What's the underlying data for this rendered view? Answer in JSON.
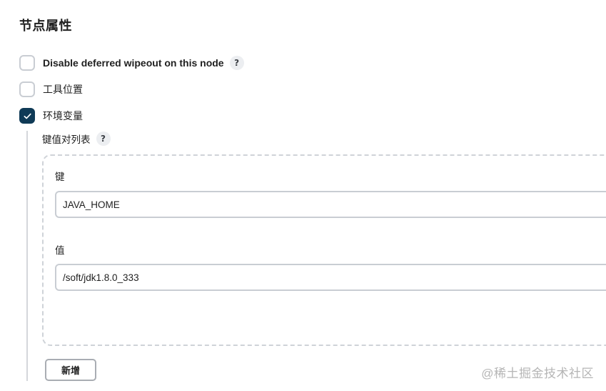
{
  "section": {
    "title": "节点属性"
  },
  "options": [
    {
      "label": "Disable deferred wipeout on this node",
      "checked": false,
      "help": "?"
    },
    {
      "label": "工具位置",
      "checked": false
    },
    {
      "label": "环境变量",
      "checked": true
    }
  ],
  "env_vars": {
    "list_label": "键值对列表",
    "list_help": "?",
    "key_label": "键",
    "key_value": "JAVA_HOME",
    "value_label": "值",
    "value_value": "/soft/jdk1.8.0_333",
    "add_label": "新增"
  },
  "watermark": "@稀土掘金技术社区",
  "colors": {
    "checked_fill": "#0f3a56",
    "border": "#c9cdd3"
  }
}
